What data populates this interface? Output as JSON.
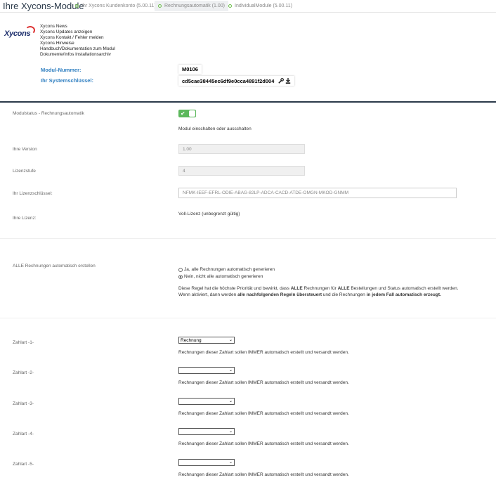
{
  "header": {
    "title": "Ihre Xycons-Module",
    "tabs": [
      {
        "label": "Ihr Xycons Kundenkonto (5.00.11)",
        "active": false
      },
      {
        "label": "Rechnungsautomatik (1.00)",
        "active": true
      },
      {
        "label": "IndividualModule (5.00.11)",
        "active": false
      }
    ]
  },
  "logo": {
    "text": "Xycons"
  },
  "links": [
    "Xycons News",
    "Xycons Updates anzeigen",
    "Xycons Kontakt / Fehler melden",
    "Xycons Hinweise",
    "Handbuch/Dokumentation zum Modul",
    "Dokumente/Infos Installationsarchiv"
  ],
  "module": {
    "nr_label": "Modul-Nummer:",
    "nr_value": "M0106",
    "key_label": "Ihr Systemschlüssel:",
    "key_value": "cd5cae38445ec6df9e0cca4891f2d004"
  },
  "fields": {
    "status_label": "Modulstatus - Rechnungsautomatik",
    "status_help": "Modul einschalten oder ausschalten",
    "version_label": "Ihre Version",
    "version_value": "1.00",
    "level_label": "Lizenzstufe",
    "level_value": "4",
    "license_key_label": "Ihr Lizenzschlüssel:",
    "license_key_value": "NFMK-IEEF-EFRL-ODIE-ABAG-82LP-ADCA-CACD-ATDE-OMGN-MKOD-GNMM",
    "license_label": "Ihre Lizenz:",
    "license_value": "Voll-Lizenz (unbegrenzt gültig)"
  },
  "all_invoices": {
    "label": "ALLE Rechnungen automatisch erstellen",
    "option_yes": "Ja, alle Rechnungen automatisch generieren",
    "option_no": "Nein, nicht alle automatisch generieren",
    "desc1_a": "Diese Regel hat die höchste Priorität und bewirkt, dass ",
    "desc1_b": "ALLE",
    "desc1_c": " Rechnungen für ",
    "desc1_d": "ALLE",
    "desc1_e": " Bestellungen und Status automatisch erstellt werden.",
    "desc2_a": "Wenn aktiviert, dann werden ",
    "desc2_b": "alle nachfolgenden Regeln übersteuert",
    "desc2_c": " und die Rechnungen ",
    "desc2_d": "in jedem Fall automatisch erzeugt."
  },
  "payment_help": "Rechnungen dieser Zahlart sollen IMMER automatisch erstellt und versandt werden.",
  "payments": [
    {
      "label": "Zahlart -1-",
      "value": "Rechnung"
    },
    {
      "label": "Zahlart -2-",
      "value": ""
    },
    {
      "label": "Zahlart -3-",
      "value": ""
    },
    {
      "label": "Zahlart -4-",
      "value": ""
    },
    {
      "label": "Zahlart -5-",
      "value": ""
    }
  ]
}
